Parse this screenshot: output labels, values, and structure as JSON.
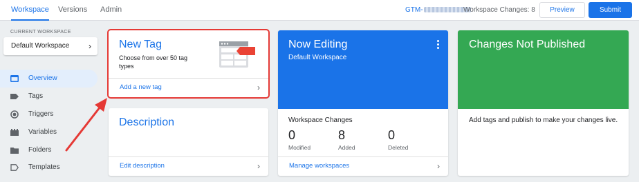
{
  "header": {
    "tabs": [
      {
        "label": "Workspace",
        "active": true
      },
      {
        "label": "Versions",
        "active": false
      },
      {
        "label": "Admin",
        "active": false
      }
    ],
    "container_id_prefix": "GTM-",
    "workspace_changes": "Workspace Changes: 8",
    "preview_label": "Preview",
    "submit_label": "Submit"
  },
  "sidebar": {
    "current_workspace_label": "CURRENT WORKSPACE",
    "workspace_name": "Default Workspace",
    "items": [
      {
        "label": "Overview",
        "icon": "overview-icon",
        "active": true
      },
      {
        "label": "Tags",
        "icon": "tag-icon",
        "active": false
      },
      {
        "label": "Triggers",
        "icon": "trigger-icon",
        "active": false
      },
      {
        "label": "Variables",
        "icon": "variables-icon",
        "active": false
      },
      {
        "label": "Folders",
        "icon": "folder-icon",
        "active": false
      },
      {
        "label": "Templates",
        "icon": "template-icon",
        "active": false
      }
    ]
  },
  "cards": {
    "new_tag": {
      "title": "New Tag",
      "subtitle": "Choose from over 50 tag types",
      "action": "Add a new tag"
    },
    "description": {
      "title": "Description",
      "action": "Edit description"
    },
    "now_editing": {
      "title": "Now Editing",
      "subtitle": "Default Workspace",
      "section_title": "Workspace Changes",
      "stats": [
        {
          "value": "0",
          "label": "Modified"
        },
        {
          "value": "8",
          "label": "Added"
        },
        {
          "value": "0",
          "label": "Deleted"
        }
      ],
      "action": "Manage workspaces"
    },
    "changes_not_published": {
      "title": "Changes Not Published",
      "body": "Add tags and publish to make your changes live."
    }
  },
  "colors": {
    "accent": "#1a73e8",
    "now_editing_bg": "#1a73e8",
    "not_published_bg": "#34a853",
    "highlight_annotation": "#e53935"
  }
}
